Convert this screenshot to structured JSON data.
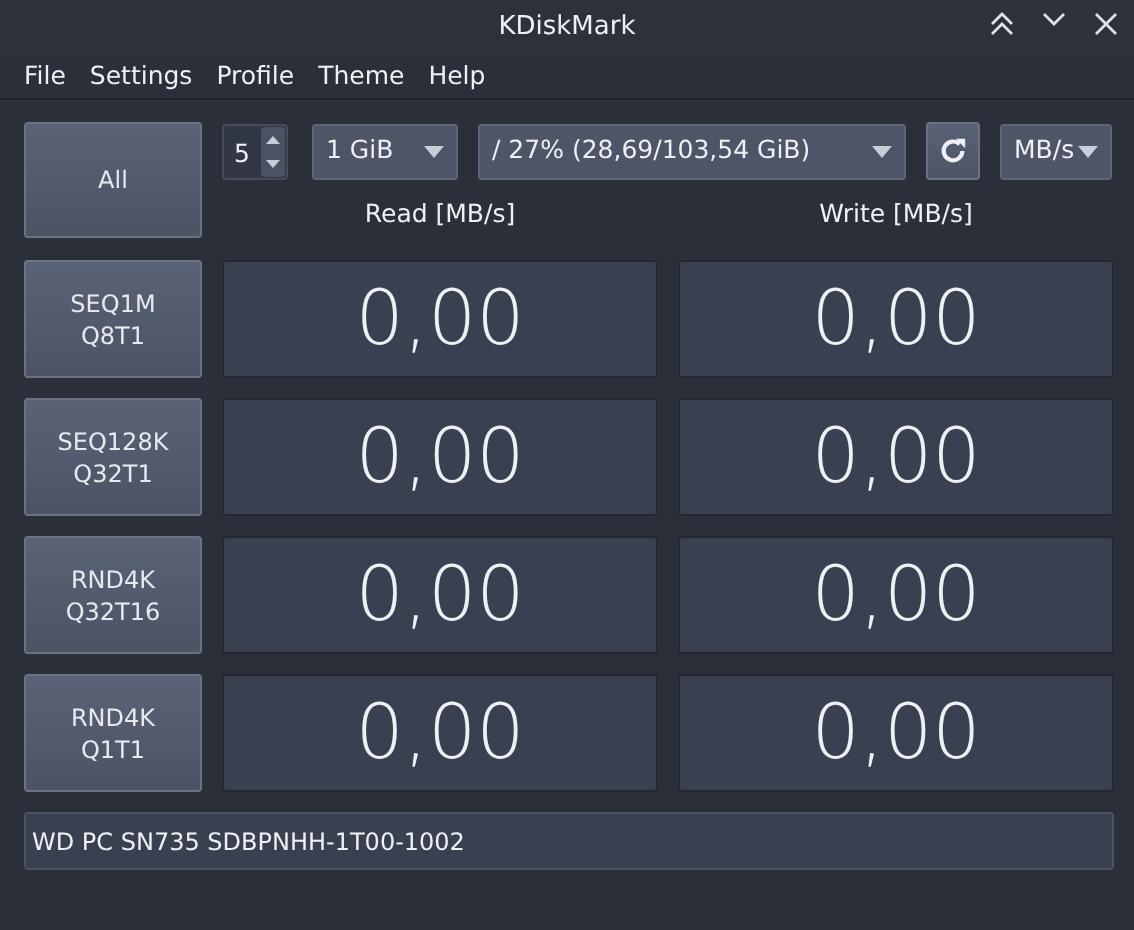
{
  "window": {
    "title": "KDiskMark"
  },
  "menu": [
    "File",
    "Settings",
    "Profile",
    "Theme",
    "Help"
  ],
  "toolbar": {
    "all_button": "All",
    "loops": "5",
    "size": "1 GiB",
    "target": "/ 27% (28,69/103,54 GiB)",
    "unit": "MB/s"
  },
  "columns": [
    "Read [MB/s]",
    "Write [MB/s]"
  ],
  "tests": [
    {
      "line1": "SEQ1M",
      "line2": "Q8T1",
      "read": "0,00",
      "write": "0,00"
    },
    {
      "line1": "SEQ128K",
      "line2": "Q32T1",
      "read": "0,00",
      "write": "0,00"
    },
    {
      "line1": "RND4K",
      "line2": "Q32T16",
      "read": "0,00",
      "write": "0,00"
    },
    {
      "line1": "RND4K",
      "line2": "Q1T1",
      "read": "0,00",
      "write": "0,00"
    }
  ],
  "device": "WD PC SN735 SDBPNHH-1T00-1002"
}
